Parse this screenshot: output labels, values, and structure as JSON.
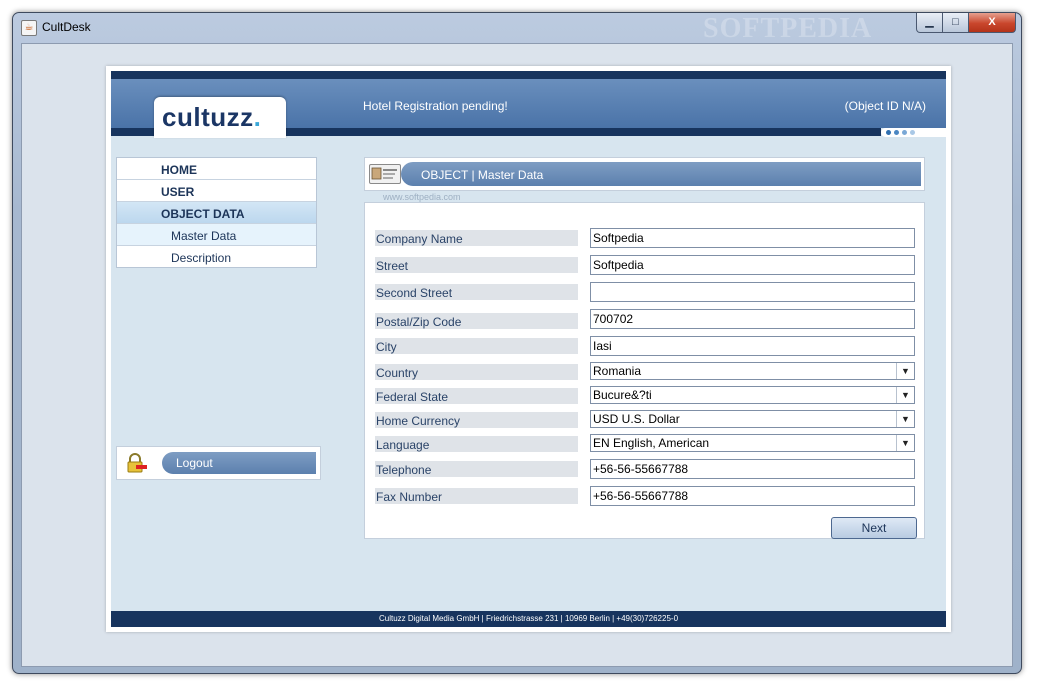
{
  "window": {
    "title": "CultDesk",
    "watermark": "SOFTPEDIA",
    "buttons": {
      "minimize": "▁",
      "maximize": "□",
      "close": "X"
    }
  },
  "header": {
    "logo_text": "cultuzz",
    "logo_dot": ".",
    "notice": "Hotel Registration pending!",
    "object_id": "(Object ID  N/A)"
  },
  "menu": {
    "items": [
      {
        "label": "HOME"
      },
      {
        "label": "USER"
      },
      {
        "label": "OBJECT DATA"
      }
    ],
    "sub_items": [
      {
        "label": "Master Data"
      },
      {
        "label": "Description"
      }
    ]
  },
  "logout": {
    "label": "Logout"
  },
  "section": {
    "title": "OBJECT  |  Master Data",
    "watermark": "www.softpedia.com"
  },
  "form": {
    "company_name": {
      "label": "Company Name",
      "value": "Softpedia"
    },
    "street": {
      "label": "Street",
      "value": "Softpedia"
    },
    "second_street": {
      "label": "Second Street",
      "value": ""
    },
    "postal_code": {
      "label": "Postal/Zip Code",
      "value": "700702"
    },
    "city": {
      "label": "City",
      "value": "Iasi"
    },
    "country": {
      "label": "Country",
      "value": "Romania"
    },
    "federal_state": {
      "label": "Federal State",
      "value": "Bucure&?ti"
    },
    "home_currency": {
      "label": "Home Currency",
      "value": "USD  U.S. Dollar"
    },
    "language": {
      "label": "Language",
      "value": "EN  English, American"
    },
    "telephone": {
      "label": "Telephone",
      "value": "+56-56-55667788"
    },
    "fax_number": {
      "label": "Fax Number",
      "value": "+56-56-55667788"
    },
    "next_label": "Next"
  },
  "footer": {
    "text": "Cultuzz Digital Media GmbH | Friedrichstrasse 231 | 10969 Berlin | +49(30)726225-0"
  },
  "colors": {
    "navy": "#17345e",
    "header_blue": "#5a80b2",
    "accent_dot": "#3aa7d8",
    "panel_bg": "#d7e5ef"
  }
}
